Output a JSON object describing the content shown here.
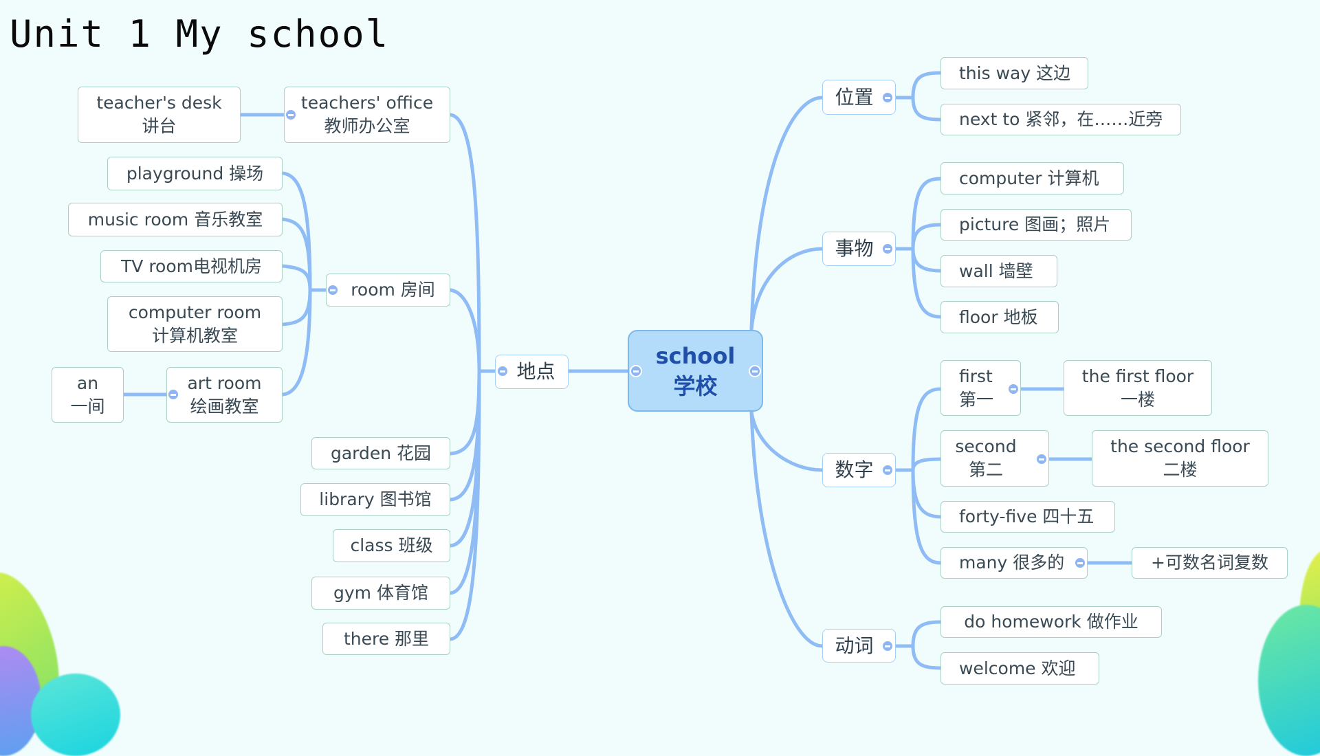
{
  "title": "Unit 1 My school",
  "root": {
    "en": "school",
    "zh": "学校"
  },
  "left": {
    "branch": "地点",
    "items": {
      "teachers_office": {
        "en": "teachers' office",
        "zh": "教师办公室"
      },
      "teachers_desk": {
        "en": "teacher's desk",
        "zh": "讲台"
      },
      "room": "room 房间",
      "playground": "playground 操场",
      "music_room": "music room 音乐教室",
      "tv_room": "TV room电视机房",
      "computer_room": {
        "en": "computer room",
        "zh": "计算机教室"
      },
      "art_room": {
        "en": "art room",
        "zh": "绘画教室"
      },
      "an": {
        "en": "an",
        "zh": "一间"
      },
      "garden": "garden 花园",
      "library": "library 图书馆",
      "class": "class 班级",
      "gym": "gym  体育馆",
      "there": "there  那里"
    }
  },
  "right": {
    "position": {
      "label": "位置",
      "items": [
        "this way 这边",
        "next to 紧邻，在……近旁"
      ]
    },
    "things": {
      "label": "事物",
      "items": [
        "computer  计算机",
        "picture 图画；照片",
        "wall 墙壁",
        "floor 地板"
      ]
    },
    "numbers": {
      "label": "数字",
      "first": {
        "en": "first",
        "zh": "第一"
      },
      "first_floor": {
        "en": "the first floor",
        "zh": "一楼"
      },
      "second": {
        "en": "second",
        "zh": "第二"
      },
      "second_floor": {
        "en": "the second floor",
        "zh": "二楼"
      },
      "forty_five": "forty-five 四十五",
      "many": "many  很多的",
      "plural": "+可数名词复数"
    },
    "verbs": {
      "label": "动词",
      "items": [
        "do homework 做作业",
        "welcome  欢迎"
      ]
    }
  },
  "colors": {
    "background": "#f1fdfd",
    "link": "#8fbcf5",
    "root_fill": "#b3dcfb",
    "root_text": "#1f4fa8"
  }
}
